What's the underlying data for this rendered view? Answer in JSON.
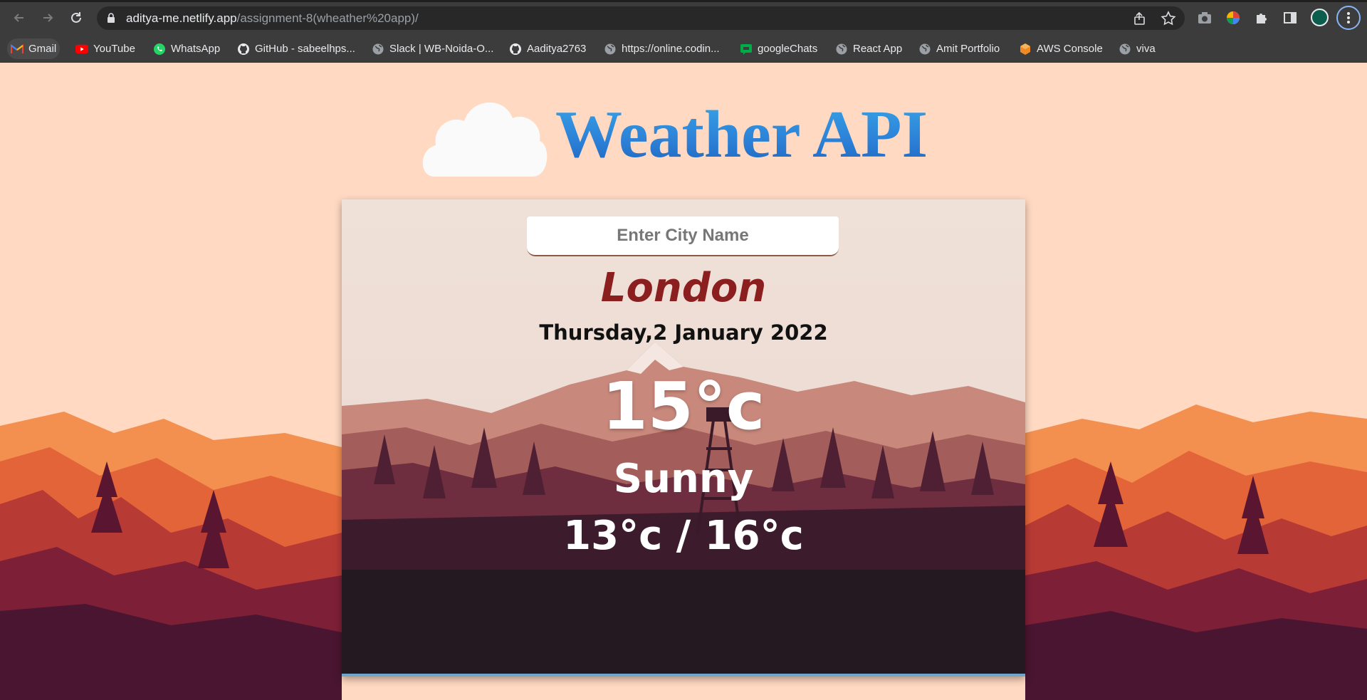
{
  "browser": {
    "url_host": "aditya-me.netlify.app",
    "url_path": "/assignment-8(wheather%20app)/",
    "bookmarks": [
      {
        "label": "Gmail",
        "icon": "gmail-icon"
      },
      {
        "label": "YouTube",
        "icon": "youtube-icon"
      },
      {
        "label": "WhatsApp",
        "icon": "whatsapp-icon"
      },
      {
        "label": "GitHub - sabeelhps...",
        "icon": "github-icon"
      },
      {
        "label": "Slack | WB-Noida-O...",
        "icon": "globe-icon"
      },
      {
        "label": "Aaditya2763",
        "icon": "github-icon"
      },
      {
        "label": "https://online.codin...",
        "icon": "globe-icon"
      },
      {
        "label": "googleChats",
        "icon": "google-chat-icon"
      },
      {
        "label": "React App",
        "icon": "globe-icon"
      },
      {
        "label": "Amit Portfolio",
        "icon": "globe-icon"
      },
      {
        "label": "AWS Console",
        "icon": "aws-icon"
      },
      {
        "label": "viva",
        "icon": "globe-icon"
      }
    ]
  },
  "app": {
    "title": "Weather API",
    "search_placeholder": "Enter City Name",
    "city": "London",
    "date": "Thursday,2 January 2022",
    "temperature": "15°c",
    "condition": "Sunny",
    "min_max": "13°c / 16°c"
  },
  "colors": {
    "page_bg": "#ffd9c2",
    "city_color": "#8b1e1e",
    "title_gradient_top": "#3aa8e8",
    "title_gradient_bottom": "#1e5fb8"
  }
}
